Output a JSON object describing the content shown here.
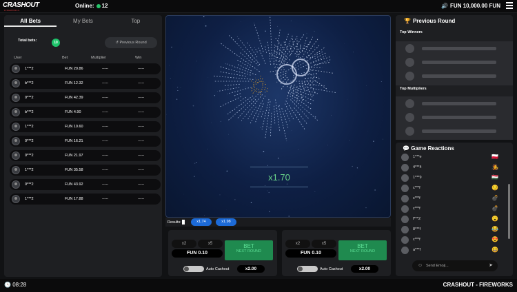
{
  "header": {
    "logo": "CRASHOUT",
    "logo_sub": "FIREWORKS",
    "online_label": "Online:",
    "online_count": "12",
    "balance": "FUN 10,000.00",
    "currency": "FUN"
  },
  "bets_panel": {
    "tabs": [
      "All Bets",
      "My Bets",
      "Top"
    ],
    "total_bets_label": "Total bets:",
    "total_bets_count": "10",
    "previous_round_label": "Previous Round",
    "columns": [
      "User",
      "Bet",
      "Multiplier",
      "Win"
    ],
    "rows": [
      {
        "user": "1***2",
        "bet": "FUN 20.86",
        "mult": "-----",
        "win": "-----"
      },
      {
        "user": "b***2",
        "bet": "FUN 12.32",
        "mult": "-----",
        "win": "-----"
      },
      {
        "user": "0***2",
        "bet": "FUN 42.39",
        "mult": "-----",
        "win": "-----"
      },
      {
        "user": "b***2",
        "bet": "FUN 4.90",
        "mult": "-----",
        "win": "-----"
      },
      {
        "user": "1***2",
        "bet": "FUN 10.60",
        "mult": "-----",
        "win": "-----"
      },
      {
        "user": "0***2",
        "bet": "FUN 16.21",
        "mult": "-----",
        "win": "-----"
      },
      {
        "user": "0***2",
        "bet": "FUN 21.97",
        "mult": "-----",
        "win": "-----"
      },
      {
        "user": "1***2",
        "bet": "FUN 35.58",
        "mult": "-----",
        "win": "-----"
      },
      {
        "user": "0***2",
        "bet": "FUN 43.92",
        "mult": "-----",
        "win": "-----"
      },
      {
        "user": "1***2",
        "bet": "FUN 17.88",
        "mult": "-----",
        "win": "-----"
      }
    ]
  },
  "game": {
    "multiplier": "x1.70",
    "results_label": "Results:",
    "results": [
      "x1.74",
      "x1.98"
    ]
  },
  "bet_boxes": [
    {
      "chip1": "x2",
      "chip2": "x5",
      "amount": "FUN 0.10",
      "bet_label": "BET",
      "bet_sub": "NEXT ROUND",
      "auto_label": "Auto Cashout",
      "auto_value": "x2.00"
    },
    {
      "chip1": "x2",
      "chip2": "x5",
      "amount": "FUN 0.10",
      "bet_label": "BET",
      "bet_sub": "NEXT ROUND",
      "auto_label": "Auto Cashout",
      "auto_value": "x2.00"
    }
  ],
  "previous_round": {
    "title": "Previous Round",
    "top_winners_label": "Top Winners",
    "top_multipliers_label": "Top Multipliers"
  },
  "reactions": {
    "title": "Game Reactions",
    "items": [
      {
        "user": "1***e",
        "emoji": "🇵🇱"
      },
      {
        "user": "4***4",
        "emoji": "🧑‍🎤"
      },
      {
        "user": "1***9",
        "emoji": "🇭🇺"
      },
      {
        "user": "c***f",
        "emoji": "😏"
      },
      {
        "user": "c***f",
        "emoji": "💣"
      },
      {
        "user": "c***f",
        "emoji": "💣"
      },
      {
        "user": "f***2",
        "emoji": "😮"
      },
      {
        "user": "8***f",
        "emoji": "😂"
      },
      {
        "user": "c***f",
        "emoji": "😍"
      },
      {
        "user": "a***f",
        "emoji": "😆"
      }
    ],
    "input_placeholder": "Send Emoji..."
  },
  "footer": {
    "time": "08:28",
    "game_name": "CRASHOUT - FIREWORKS"
  },
  "colors": {
    "accent_green": "#1ec46b",
    "result_pill": "#1c6ad7",
    "multiplier": "#6ad68a"
  }
}
